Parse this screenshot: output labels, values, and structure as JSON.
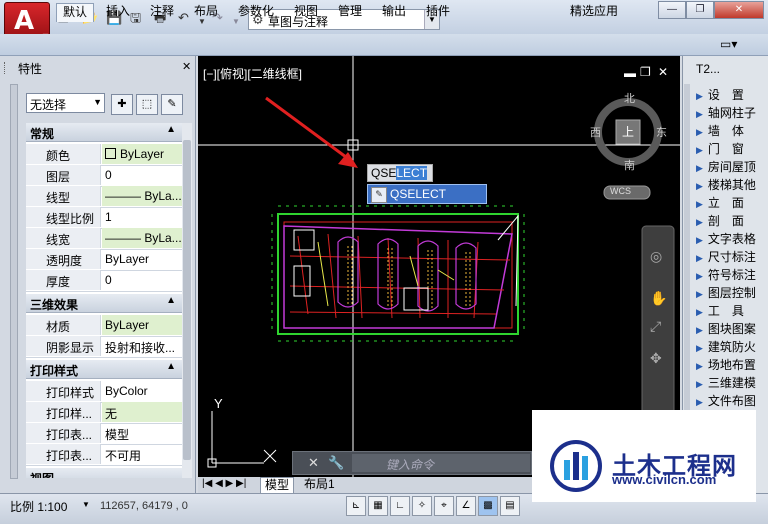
{
  "titlebar": {
    "workspace": "草图与注释",
    "quick_access": [
      "new-icon",
      "open-icon",
      "save-icon",
      "saveas-icon",
      "print-icon",
      "undo-icon",
      "redo-icon"
    ]
  },
  "ribbon_tabs": [
    "默认",
    "插入",
    "注释",
    "布局",
    "参数化",
    "视图",
    "管理",
    "输出",
    "插件",
    "精选应用"
  ],
  "properties": {
    "title": "特性",
    "selection": "无选择",
    "sections": [
      {
        "name": "常规",
        "rows": [
          {
            "k": "颜色",
            "v": "ByLayer",
            "hl": true
          },
          {
            "k": "图层",
            "v": "0",
            "hl": false
          },
          {
            "k": "线型",
            "v": "——— ByLa...",
            "hl": true
          },
          {
            "k": "线型比例",
            "v": "1",
            "hl": false
          },
          {
            "k": "线宽",
            "v": "——— ByLa...",
            "hl": true
          },
          {
            "k": "透明度",
            "v": "ByLayer",
            "hl": false
          },
          {
            "k": "厚度",
            "v": "0",
            "hl": false
          }
        ]
      },
      {
        "name": "三维效果",
        "rows": [
          {
            "k": "材质",
            "v": "ByLayer",
            "hl": true
          },
          {
            "k": "阴影显示",
            "v": "投射和接收...",
            "hl": false
          }
        ]
      },
      {
        "name": "打印样式",
        "rows": [
          {
            "k": "打印样式",
            "v": "ByColor",
            "hl": false
          },
          {
            "k": "打印样...",
            "v": "无",
            "hl": true
          },
          {
            "k": "打印表...",
            "v": "模型",
            "hl": false
          },
          {
            "k": "打印表...",
            "v": "不可用",
            "hl": false
          }
        ]
      },
      {
        "name": "视图",
        "rows": []
      }
    ]
  },
  "viewport": {
    "label": "[−][俯视][二维线框]",
    "compass": {
      "n": "北",
      "s": "南",
      "e": "东",
      "w": "西",
      "top": "上",
      "ucs": "WCS"
    },
    "ucs_y": "Y",
    "qselect_typed": "QSE",
    "qselect_typed_sel": "LECT",
    "qselect_suggestion": "QSELECT"
  },
  "cmdline": {
    "placeholder": "键入命令"
  },
  "layout_tabs": [
    "模型",
    "布局1"
  ],
  "t2": {
    "title": "T2...",
    "items": [
      "设　置",
      "轴网柱子",
      "墙　体",
      "门　窗",
      "房间屋顶",
      "楼梯其他",
      "立　面",
      "剖　面",
      "文字表格",
      "尺寸标注",
      "符号标注",
      "图层控制",
      "工　具",
      "图块图案",
      "建筑防火",
      "场地布置",
      "三维建模",
      "文件布图"
    ]
  },
  "status": {
    "scale_label": "比例 1:100",
    "coords": "112657, 64179 , 0"
  },
  "watermark": {
    "title": "土木工程网",
    "url": "www.civilcn.com"
  }
}
